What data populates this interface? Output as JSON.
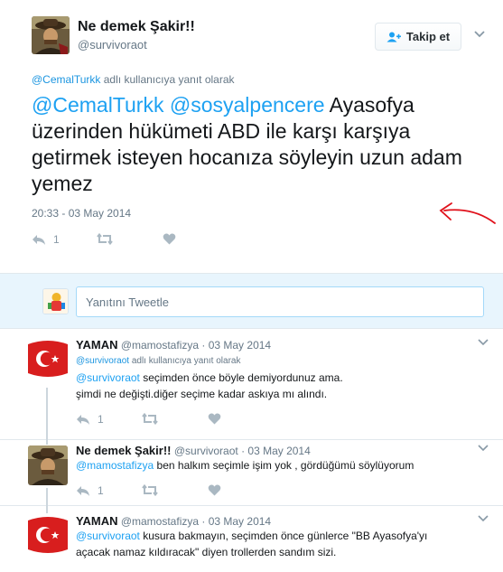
{
  "main_tweet": {
    "author_name": "Ne demek Şakir!!",
    "author_handle": "@survivoraot",
    "follow_label": "Takip et",
    "reply_to_user": "@CemalTurkk",
    "reply_to_suffix": " adlı kullanıcıya yanıt olarak",
    "mention_1": "@CemalTurkk",
    "mention_2": "@sosyalpencere",
    "text": " Ayasofya üzerinden hükümeti ABD ile karşı karşıya getirmek isteyen hocanıza söyleyin uzun adam yemez",
    "timestamp": "20:33 - 03 May 2014",
    "reply_count": "1"
  },
  "reply_box": {
    "placeholder": "Yanıtını Tweetle"
  },
  "replies": [
    {
      "name": "YAMAN",
      "handle": "@mamostafizya",
      "date": "· 03 May 2014",
      "reply_to_user": "@survivoraot",
      "reply_to_suffix": " adlı kullanıcıya yanıt olarak",
      "mention": "@survivoraot",
      "text_1": " seçimden önce böyle demiyordunuz ama.",
      "text_2": "şimdi ne değişti.diğer seçime kadar askıya mı alındı.",
      "reply_count": "1"
    },
    {
      "name": "Ne demek Şakir!!",
      "handle": "@survivoraot",
      "date": "· 03 May 2014",
      "mention": "@mamostafizya",
      "text_1": " ben halkım seçimle işim yok , gördüğümü söylüyorum",
      "reply_count": "1"
    },
    {
      "name": "YAMAN",
      "handle": "@mamostafizya",
      "date": "· 03 May 2014",
      "mention": "@survivoraot",
      "text_1": " kusura bakmayın, seçimden önce günlerce \"BB Ayasofya'yı",
      "text_2": "açacak namaz kıldıracak\" diyen trollerden sandım sizi."
    }
  ],
  "colors": {
    "link": "#1da1f2",
    "muted": "#657786",
    "action": "#8899a6",
    "reply_bar": "#e8f5fd",
    "annotation": "#e0101a"
  }
}
